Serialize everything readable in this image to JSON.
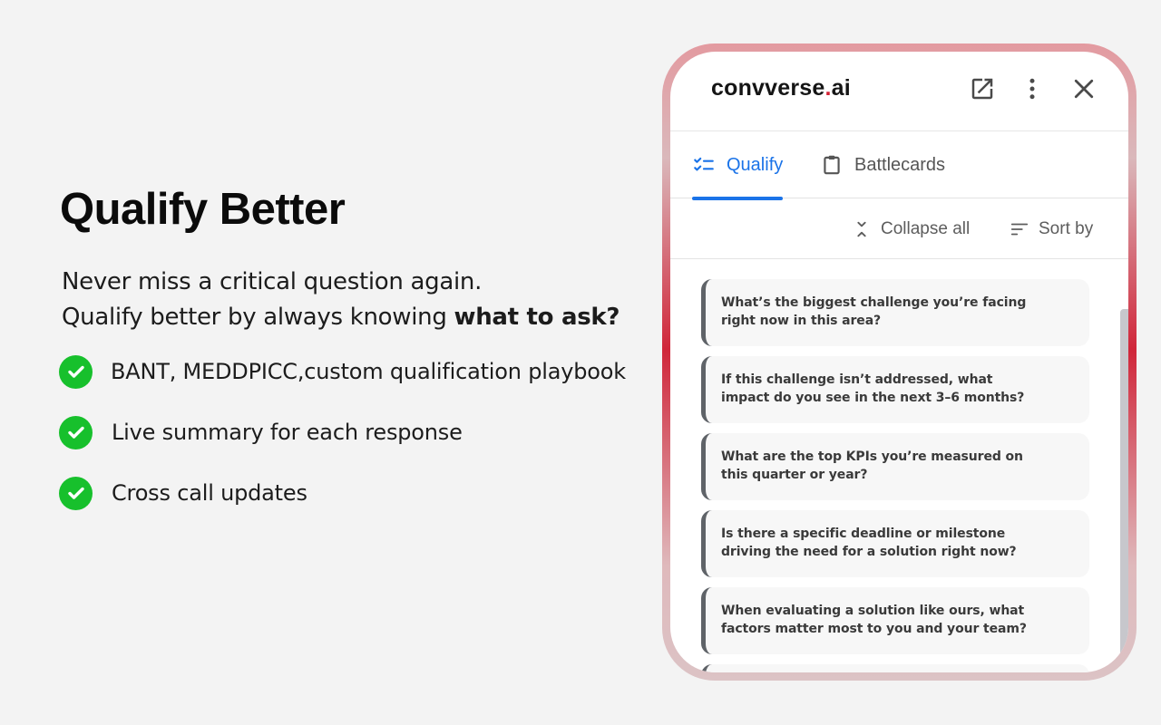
{
  "hero": {
    "title": "Qualify Better",
    "subtitle_line1": "Never miss a critical question again.",
    "subtitle_line2_prefix": "Qualify better by always knowing ",
    "subtitle_line2_bold": "what to ask?"
  },
  "features": [
    {
      "label": "BANT, MEDDPICC,custom qualification playbook",
      "icon": "check-circle-icon"
    },
    {
      "label": "Live summary for each response",
      "icon": "check-circle-icon"
    },
    {
      "label": "Cross call updates",
      "icon": "check-circle-icon"
    }
  ],
  "app": {
    "brand_prefix": "convverse",
    "brand_dot": ".",
    "brand_suffix": "ai",
    "icons": [
      "open-in-new-icon",
      "more-vertical-icon",
      "close-icon"
    ],
    "tabs": [
      {
        "label": "Qualify",
        "icon": "checklist-icon",
        "active": true
      },
      {
        "label": "Battlecards",
        "icon": "clipboard-icon",
        "active": false
      }
    ],
    "toolbar": {
      "collapse_label": "Collapse all",
      "sort_label": "Sort by"
    },
    "questions": [
      "What’s the biggest challenge you’re facing right now in this area?",
      "If this challenge isn’t addressed, what impact do you see in the next 3–6 months?",
      "What are the top KPIs you’re measured on this quarter or year?",
      "Is there a specific deadline or milestone driving the need for a solution right now?",
      "When evaluating a solution like ours, what factors matter most to you and your team?"
    ]
  },
  "colors": {
    "accent": "#1a73e8",
    "check": "#17c02c",
    "brand_dot": "#d32032"
  }
}
